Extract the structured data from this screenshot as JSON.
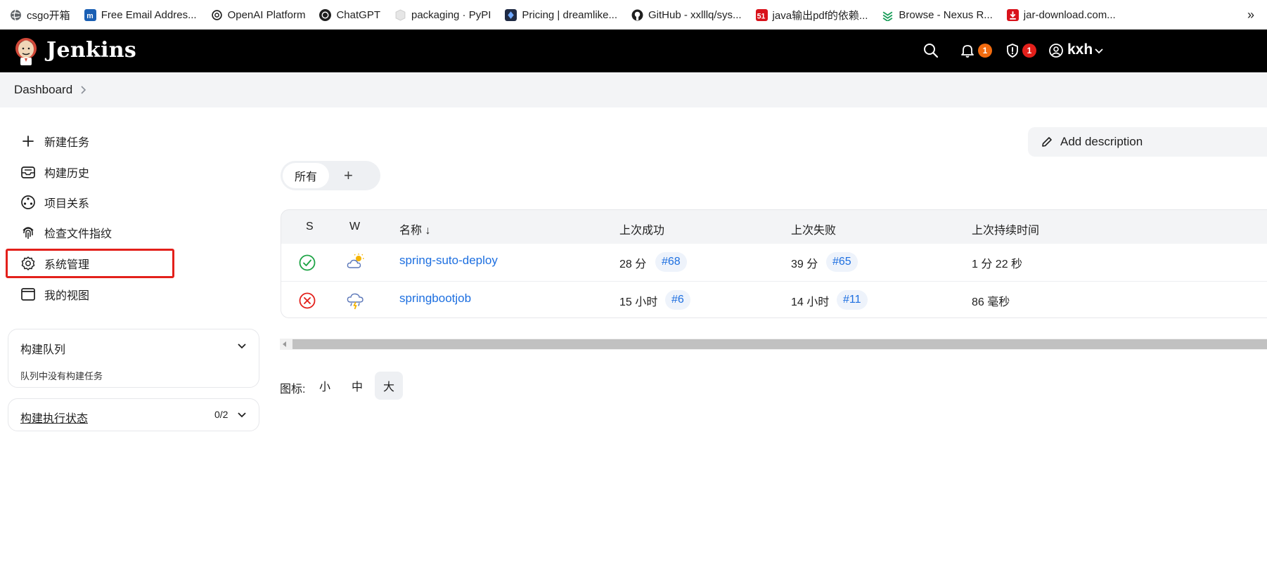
{
  "bookmarks": [
    {
      "label": "csgo开箱",
      "icon": "globe-icon",
      "color": "#5f6368"
    },
    {
      "label": "Free Email Addres...",
      "icon": "m-logo-icon",
      "color": "#1a5fb4"
    },
    {
      "label": "OpenAI Platform",
      "icon": "openai-icon",
      "color": "#1f1f1f"
    },
    {
      "label": "ChatGPT",
      "icon": "chatgpt-icon",
      "color": "#1f1f1f"
    },
    {
      "label": "packaging · PyPI",
      "icon": "pypi-icon",
      "color": "#d7d7d7"
    },
    {
      "label": "Pricing | dreamlike...",
      "icon": "dreamlike-icon",
      "color": "#1f2a44"
    },
    {
      "label": "GitHub - xxlllq/sys...",
      "icon": "github-icon",
      "color": "#1f1f1f"
    },
    {
      "label": "java输出pdf的依赖...",
      "icon": "51cto-icon",
      "color": "#d9121b"
    },
    {
      "label": "Browse - Nexus R...",
      "icon": "nexus-icon",
      "color": "#1b9e5a"
    },
    {
      "label": "jar-download.com...",
      "icon": "jar-download-icon",
      "color": "#d9121b"
    }
  ],
  "bookmarks_more": "»",
  "header": {
    "brand": "Jenkins",
    "notifications_count": "1",
    "security_count": "1",
    "user": "kxh",
    "notify_badge_color": "#f26b0f",
    "security_badge_color": "#e3201b"
  },
  "breadcrumb": {
    "root": "Dashboard"
  },
  "sidebar": {
    "items": [
      {
        "label": "新建任务",
        "icon": "plus-icon"
      },
      {
        "label": "构建历史",
        "icon": "inbox-icon"
      },
      {
        "label": "项目关系",
        "icon": "relations-icon"
      },
      {
        "label": "检查文件指纹",
        "icon": "fingerprint-icon"
      },
      {
        "label": "系统管理",
        "icon": "gear-icon"
      },
      {
        "label": "我的视图",
        "icon": "window-icon"
      }
    ],
    "queue": {
      "title": "构建队列",
      "empty_text": "队列中没有构建任务"
    },
    "executors": {
      "title": "构建执行状态",
      "count": "0/2"
    }
  },
  "main": {
    "add_description": "Add description",
    "tabs": [
      {
        "label": "所有"
      }
    ],
    "add_tab": "+",
    "columns": [
      "S",
      "W",
      "名称 ↓",
      "上次成功",
      "上次失败",
      "上次持续时间"
    ],
    "rows": [
      {
        "status": "success",
        "weather": "partly-sunny",
        "name": "spring-suto-deploy",
        "last_success": "28 分",
        "last_success_build": "#68",
        "last_failure": "39 分",
        "last_failure_build": "#65",
        "duration": "1 分 22 秒"
      },
      {
        "status": "failed",
        "weather": "thunderstorm",
        "name": "springbootjob",
        "last_success": "15 小时",
        "last_success_build": "#6",
        "last_failure": "14 小时",
        "last_failure_build": "#11",
        "duration": "86 毫秒"
      }
    ],
    "icon_size_label": "图标:",
    "icon_sizes": [
      "小",
      "中",
      "大"
    ],
    "icon_size_selected": "大"
  },
  "colors": {
    "success": "#1ea446",
    "failure": "#e3201b",
    "link": "#1d6fe0",
    "highlight": "#e3201b"
  }
}
